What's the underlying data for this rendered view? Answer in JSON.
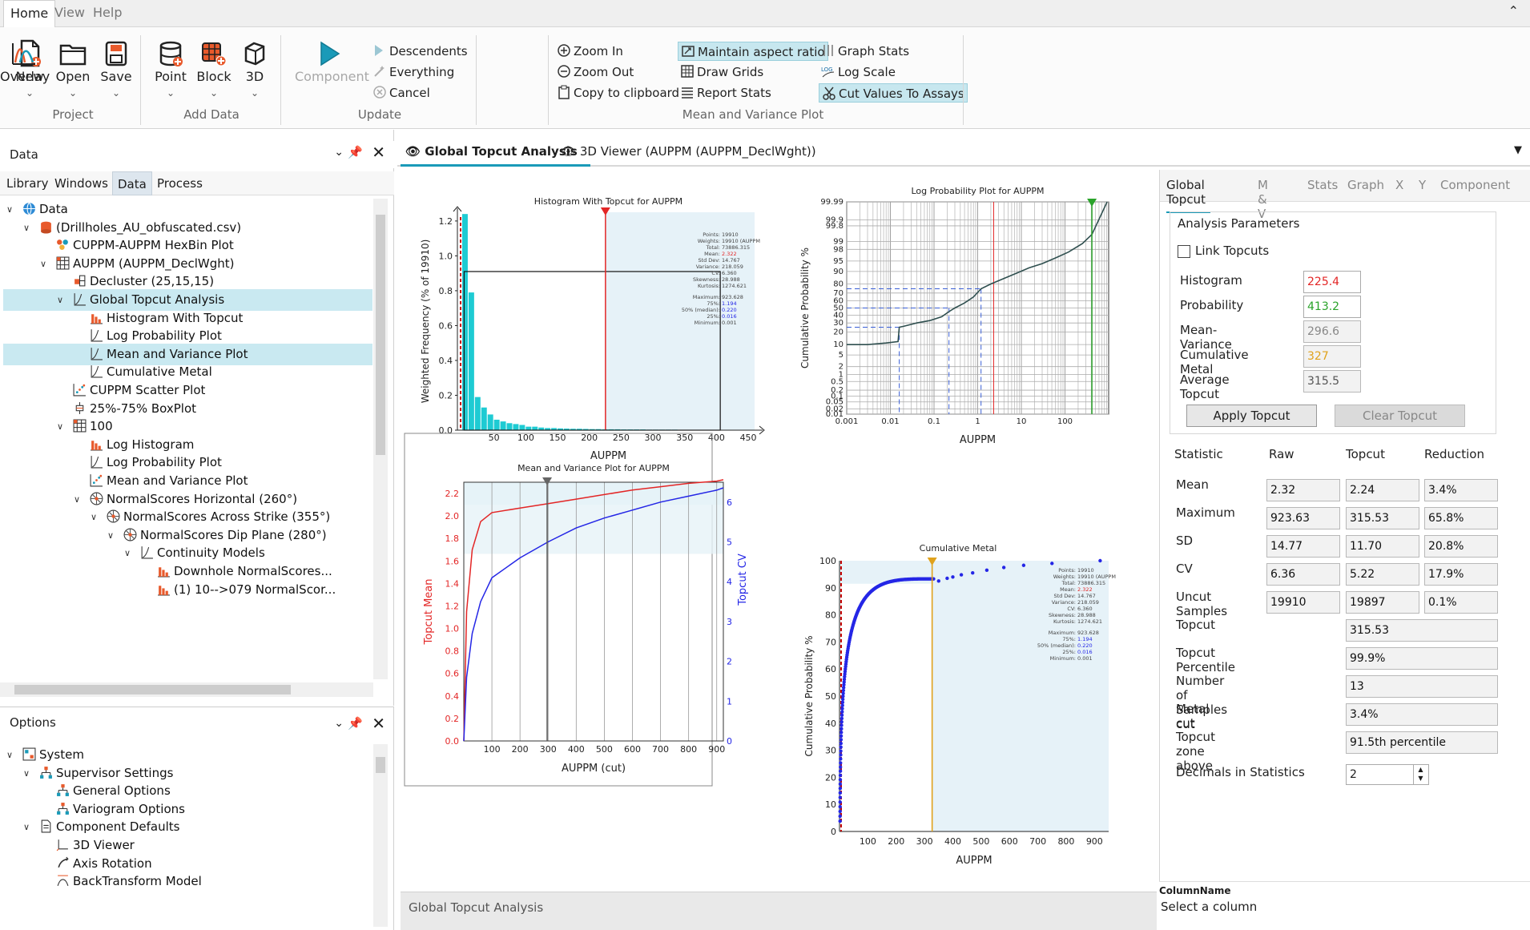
{
  "menu": {
    "items": [
      "Home",
      "View",
      "Help"
    ]
  },
  "ribbon": {
    "project": {
      "new": "New",
      "open": "Open",
      "save": "Save",
      "label": "Project"
    },
    "add_data": {
      "point": "Point",
      "block": "Block",
      "three_d": "3D",
      "label": "Add Data"
    },
    "update": {
      "component": "Component",
      "descendents": "Descendents",
      "everything": "Everything",
      "cancel": "Cancel",
      "label": "Update"
    },
    "overlay": "Overlay",
    "mv": {
      "zoom_in": "Zoom In",
      "zoom_out": "Zoom Out",
      "copy": "Copy to clipboard",
      "maintain": "Maintain aspect ratio",
      "draw_grids": "Draw Grids",
      "report_stats": "Report Stats",
      "graph_stats": "Graph Stats",
      "log_scale": "Log Scale",
      "cut_values": "Cut Values To Assays",
      "label": "Mean and Variance Plot"
    }
  },
  "data_panel": {
    "title": "Data",
    "tabs": [
      "Library",
      "Windows",
      "Data",
      "Process"
    ],
    "tree": [
      {
        "label": "Data",
        "icon": "globe-icon"
      },
      {
        "label": "(Drillholes_AU_obfuscated.csv)",
        "icon": "database-icon"
      },
      {
        "label": "CUPPM-AUPPM HexBin Plot",
        "icon": "hexbin-icon"
      },
      {
        "label": "AUPPM (AUPPM_DeclWght)",
        "icon": "table-icon"
      },
      {
        "label": "Decluster (25,15,15)",
        "icon": "decluster-icon"
      },
      {
        "label": "Global Topcut Analysis",
        "icon": "line-chart-icon"
      },
      {
        "label": "Histogram With Topcut",
        "icon": "histogram-icon"
      },
      {
        "label": "Log Probability Plot",
        "icon": "line-chart-icon"
      },
      {
        "label": "Mean and Variance Plot",
        "icon": "line-chart-icon"
      },
      {
        "label": "Cumulative Metal",
        "icon": "line-chart-icon"
      },
      {
        "label": "CUPPM Scatter Plot",
        "icon": "scatter-icon"
      },
      {
        "label": "25%-75% BoxPlot",
        "icon": "boxplot-icon"
      },
      {
        "label": "100",
        "icon": "table-icon"
      },
      {
        "label": "Log Histogram",
        "icon": "histogram-icon"
      },
      {
        "label": "Log Probability Plot",
        "icon": "line-chart-icon"
      },
      {
        "label": "Mean and Variance Plot",
        "icon": "scatter-icon"
      },
      {
        "label": "NormalScores Horizontal (260°)",
        "icon": "compass-icon"
      },
      {
        "label": "NormalScores Across Strike (355°)",
        "icon": "compass-icon"
      },
      {
        "label": "NormalScores Dip Plane (280°)",
        "icon": "compass-icon"
      },
      {
        "label": "Continuity Models",
        "icon": "line-chart-icon"
      },
      {
        "label": "Downhole  NormalScores...",
        "icon": "histogram-icon"
      },
      {
        "label": "(1) 10-->079 NormalScor...",
        "icon": "histogram-icon"
      }
    ]
  },
  "options_panel": {
    "title": "Options",
    "tree": [
      {
        "label": "System",
        "icon": "system-icon"
      },
      {
        "label": "Supervisor Settings",
        "icon": "hierarchy-icon"
      },
      {
        "label": "General Options",
        "icon": "hierarchy-icon"
      },
      {
        "label": "Variogram Options",
        "icon": "hierarchy-icon"
      },
      {
        "label": "Component Defaults",
        "icon": "document-icon"
      },
      {
        "label": "3D Viewer",
        "icon": "axes-icon"
      },
      {
        "label": "Axis Rotation",
        "icon": "rotate-icon"
      },
      {
        "label": "BackTransform Model",
        "icon": "transform-icon"
      }
    ]
  },
  "doc_tabs": [
    "Global Topcut Analysis",
    "3D Viewer (AUPPM (AUPPM_DeclWght))"
  ],
  "bottom_tab": "Global Topcut Analysis",
  "charts": {
    "histogram": {
      "title": "Histogram With Topcut for AUPPM",
      "xlabel": "AUPPM",
      "ylabel": "Weighted Frequency (% of 19910)",
      "stats_labels": [
        "Points:",
        "Weights:",
        "Total:",
        "Mean:",
        "Std Dev:",
        "Variance:",
        "CV:",
        "Skewness:",
        "Kurtosis:",
        "Maximum:",
        "75%:",
        "50% (median):",
        "25%:",
        "Minimum:"
      ],
      "stats_values": [
        "19910",
        "19910 (AUPPM",
        "73886.315",
        "2.322",
        "14.767",
        "218.059",
        "6.360",
        "28.988",
        "1274.621",
        "923.628",
        "1.194",
        "0.220",
        "0.016",
        "0.001"
      ]
    },
    "logprob": {
      "title": "Log Probability Plot for AUPPM",
      "xlabel": "AUPPM",
      "ylabel": "Cumulative Probability %"
    },
    "meanvar": {
      "title": "Mean and Variance Plot for AUPPM",
      "xlabel": "AUPPM (cut)",
      "ylabel_left": "Topcut Mean",
      "ylabel_right": "Topcut CV"
    },
    "cummetal": {
      "title": "Cumulative Metal",
      "xlabel": "AUPPM",
      "ylabel": "Cumulative Probability %"
    }
  },
  "chart_data": [
    {
      "type": "bar",
      "title": "Histogram With Topcut for AUPPM",
      "xlabel": "AUPPM",
      "ylabel": "Weighted Frequency (% of 19910)",
      "x": [
        5,
        15,
        25,
        35,
        45,
        55,
        65,
        75,
        85,
        95,
        105,
        115,
        125,
        135,
        145,
        155,
        165,
        175,
        185,
        195,
        205,
        215,
        225,
        235,
        245,
        255,
        265,
        275,
        285,
        295,
        305,
        315,
        325,
        335,
        345,
        355,
        365,
        375,
        385,
        395,
        405,
        415,
        425,
        435,
        445
      ],
      "values": [
        1.24,
        0.79,
        0.19,
        0.13,
        0.09,
        0.06,
        0.05,
        0.04,
        0.035,
        0.03,
        0.02,
        0.02,
        0.015,
        0.012,
        0.012,
        0.01,
        0.009,
        0.008,
        0.008,
        0.007,
        0.006,
        0.006,
        0.005,
        0.005,
        0.005,
        0.004,
        0.004,
        0.004,
        0.004,
        0.003,
        0.003,
        0.003,
        0.003,
        0.003,
        0.002,
        0.002,
        0.002,
        0.002,
        0.002,
        0.002,
        0.002,
        0.002,
        0.002,
        0.002,
        0.002
      ],
      "xticks": [
        50,
        100,
        150,
        200,
        250,
        300,
        350,
        400,
        450
      ],
      "yticks": [
        0.0,
        0.2,
        0.4,
        0.6,
        0.8,
        1.0,
        1.2
      ],
      "xlim": [
        0,
        460
      ],
      "ylim": [
        0,
        1.25
      ],
      "topcut": 225.4,
      "grid": false
    },
    {
      "type": "line",
      "title": "Log Probability Plot for AUPPM",
      "xlabel": "AUPPM",
      "ylabel": "Cumulative Probability %",
      "x_scale": "log",
      "x": [
        0.001,
        0.003,
        0.008,
        0.015,
        0.016,
        0.02,
        0.04,
        0.08,
        0.15,
        0.22,
        0.3,
        0.5,
        0.8,
        1.194,
        2,
        4,
        8,
        15,
        30,
        60,
        120,
        250,
        413.2,
        923.6
      ],
      "y": [
        10,
        10,
        11,
        12,
        25,
        26,
        30,
        33,
        38,
        45,
        50,
        57,
        65,
        75,
        80,
        85,
        89,
        92,
        94,
        96,
        97.5,
        98.8,
        99.5,
        99.99
      ],
      "yticks": [
        "0.01",
        "0.02",
        "0.05",
        "0.1",
        "0.2",
        "0.5",
        "1",
        "2",
        "5",
        "10",
        "20",
        "30",
        "40",
        "50",
        "60",
        "70",
        "80",
        "90",
        "95",
        "98",
        "99",
        "99.8",
        "99.9",
        "99.99"
      ],
      "xticks": [
        "0.001",
        "0.01",
        "0.1",
        "1",
        "10",
        "100"
      ],
      "topcut": 413.2,
      "grid": true
    },
    {
      "type": "line",
      "title": "Mean and Variance Plot for AUPPM",
      "xlabel": "AUPPM (cut)",
      "series": [
        {
          "name": "Topcut Mean",
          "x": [
            0,
            10,
            30,
            60,
            100,
            200,
            300,
            400,
            500,
            600,
            700,
            800,
            900,
            923.6
          ],
          "y": [
            0,
            1.15,
            1.7,
            1.95,
            2.03,
            2.07,
            2.11,
            2.15,
            2.19,
            2.23,
            2.26,
            2.29,
            2.31,
            2.322
          ]
        },
        {
          "name": "Topcut CV",
          "x": [
            0,
            10,
            30,
            60,
            100,
            200,
            300,
            400,
            500,
            600,
            700,
            800,
            900,
            923.6
          ],
          "y": [
            0,
            1.6,
            2.7,
            3.5,
            4.1,
            4.6,
            5.0,
            5.35,
            5.6,
            5.8,
            6.0,
            6.15,
            6.3,
            6.36
          ]
        }
      ],
      "xticks": [
        100,
        200,
        300,
        400,
        500,
        600,
        700,
        800,
        900
      ],
      "ylim_left": [
        0,
        2.3
      ],
      "ylim_right": [
        0,
        6.5
      ],
      "topcut": 296.6,
      "grid": true
    },
    {
      "type": "scatter",
      "title": "Cumulative Metal",
      "xlabel": "AUPPM",
      "ylabel": "Cumulative Probability %",
      "x": [
        2,
        5,
        10,
        15,
        20,
        30,
        40,
        60,
        80,
        100,
        120,
        150,
        180,
        200,
        220,
        250,
        280,
        300,
        320,
        350,
        380,
        400,
        430,
        470,
        520,
        580,
        650,
        750,
        920
      ],
      "y": [
        40,
        48,
        55,
        60,
        64,
        68,
        71,
        74,
        77,
        79,
        81,
        83,
        85,
        86,
        87,
        88,
        89.5,
        90,
        91.5,
        92.5,
        93.5,
        94,
        94.8,
        95.5,
        96.5,
        97.5,
        98.3,
        99,
        100
      ],
      "xticks": [
        100,
        200,
        300,
        400,
        500,
        600,
        700,
        800,
        900
      ],
      "yticks": [
        0,
        10,
        20,
        30,
        40,
        50,
        60,
        70,
        80,
        90,
        100
      ],
      "topcut": 327,
      "grid": false
    }
  ],
  "right_panel": {
    "tabs": [
      "Global Topcut",
      "M & V",
      "Stats",
      "Graph",
      "X",
      "Y",
      "Component"
    ],
    "group_title": "Analysis Parameters",
    "link_topcuts": "Link Topcuts",
    "params": [
      {
        "label": "Histogram",
        "value": "225.4",
        "color": "#e32626"
      },
      {
        "label": "Probability",
        "value": "413.2",
        "color": "#2aa32a"
      },
      {
        "label": "Mean-Variance",
        "value": "296.6",
        "color": "#888888"
      },
      {
        "label": "Cumulative Metal",
        "value": "327",
        "color": "#e0a21c"
      },
      {
        "label": "Average Topcut",
        "value": "315.5",
        "color": "#555555"
      }
    ],
    "apply": "Apply Topcut",
    "clear": "Clear Topcut",
    "headers": [
      "Statistic",
      "Raw",
      "Topcut",
      "Reduction"
    ],
    "stats": [
      {
        "label": "Mean",
        "raw": "2.32",
        "topcut": "2.24",
        "reduction": "3.4%"
      },
      {
        "label": "Maximum",
        "raw": "923.63",
        "topcut": "315.53",
        "reduction": "65.8%"
      },
      {
        "label": "SD",
        "raw": "14.77",
        "topcut": "11.70",
        "reduction": "20.8%"
      },
      {
        "label": "CV",
        "raw": "6.36",
        "topcut": "5.22",
        "reduction": "17.9%"
      },
      {
        "label": "Uncut Samples",
        "raw": "19910",
        "topcut": "19897",
        "reduction": "0.1%"
      }
    ],
    "single": [
      {
        "label": "Topcut",
        "value": "315.53"
      },
      {
        "label": "Topcut Percentile",
        "value": "99.9%"
      },
      {
        "label": "Number of Samples cut",
        "value": "13"
      },
      {
        "label": "Metal cut",
        "value": "3.4%"
      },
      {
        "label": "Topcut zone above",
        "value": "91.5th percentile"
      }
    ],
    "decimals_label": "Decimals in Statistics",
    "decimals_value": "2",
    "column_name_title": "ColumnName",
    "column_name_desc": "Select a column"
  },
  "colors": {
    "accent": "#1a9ab8",
    "selection": "#c9e9f1",
    "bar": "#1ecbd3",
    "topcut_shade": "#e6f2f8",
    "red": "#e53535",
    "blue": "#2426e6"
  }
}
